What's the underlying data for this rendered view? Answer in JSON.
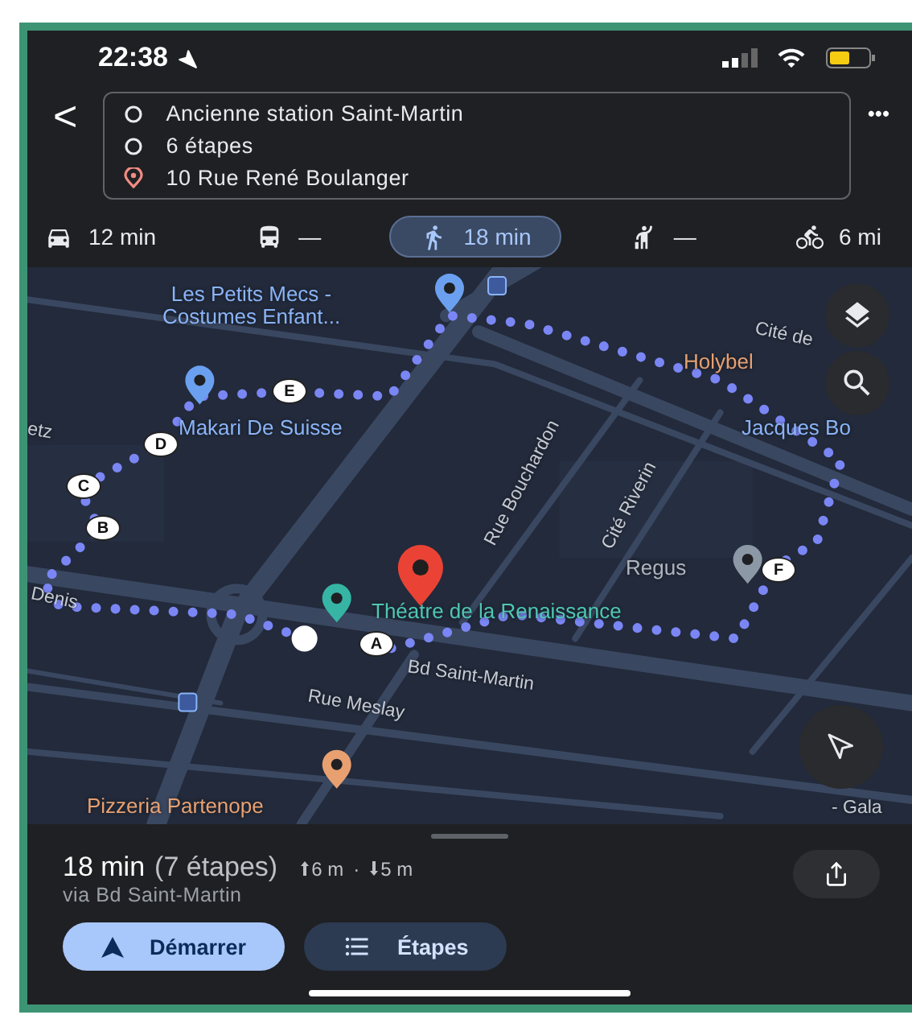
{
  "status_bar": {
    "time": "22:38"
  },
  "route": {
    "back": "<",
    "more": "•••",
    "fields": [
      {
        "kind": "origin",
        "text": "Ancienne station Saint-Martin"
      },
      {
        "kind": "stop",
        "text": "6 étapes"
      },
      {
        "kind": "destination",
        "text": "10 Rue René Boulanger"
      }
    ]
  },
  "modes": [
    {
      "kind": "car",
      "label": "12 min",
      "selected": false
    },
    {
      "kind": "transit",
      "label": "—",
      "selected": false
    },
    {
      "kind": "walk",
      "label": "18 min",
      "selected": true
    },
    {
      "kind": "ride",
      "label": "—",
      "selected": false
    },
    {
      "kind": "bike",
      "label": "6 mi",
      "selected": false
    }
  ],
  "map": {
    "labels": [
      {
        "kind": "place",
        "lines": [
          "Les Petits Mecs -",
          "Costumes Enfant..."
        ]
      },
      {
        "kind": "street",
        "lines": [
          "Cité de"
        ]
      },
      {
        "kind": "food",
        "lines": [
          "Holybel"
        ]
      },
      {
        "kind": "place",
        "lines": [
          "Makari De Suisse"
        ]
      },
      {
        "kind": "place",
        "lines": [
          "Jacques Bo"
        ]
      },
      {
        "kind": "street",
        "lines": [
          "etz"
        ]
      },
      {
        "kind": "street",
        "lines": [
          "Rue Bouchardon"
        ]
      },
      {
        "kind": "street",
        "lines": [
          "Cité Riverin"
        ]
      },
      {
        "kind": "office",
        "lines": [
          "Regus"
        ]
      },
      {
        "kind": "street",
        "lines": [
          "Denis"
        ]
      },
      {
        "kind": "venue",
        "lines": [
          "Théatre de la Renaissance"
        ]
      },
      {
        "kind": "street",
        "lines": [
          "Bd Saint-Martin"
        ]
      },
      {
        "kind": "street",
        "lines": [
          "Rue Meslay"
        ]
      },
      {
        "kind": "food",
        "lines": [
          "Pizzeria Partenope"
        ]
      },
      {
        "kind": "street",
        "lines": [
          "- Gala"
        ]
      }
    ],
    "stops": [
      "A",
      "B",
      "C",
      "D",
      "E",
      "F"
    ]
  },
  "summary": {
    "duration": "18 min",
    "stops": "(7 étapes)",
    "climb": "6 m",
    "separator": "·",
    "descent": "5 m",
    "via": "via Bd Saint-Martin"
  },
  "buttons": [
    {
      "kind": "primary",
      "label": "Démarrer"
    },
    {
      "kind": "secondary",
      "label": "Étapes"
    }
  ]
}
